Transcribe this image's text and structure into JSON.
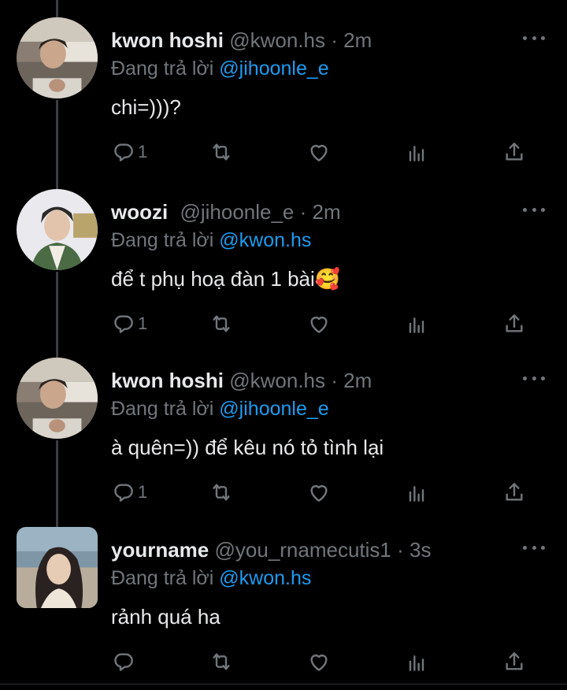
{
  "tweets": [
    {
      "display_name": "kwon hoshi",
      "handle": "@kwon.hs",
      "dot": "·",
      "time": "2m",
      "reply_prefix": "Đang trả lời",
      "reply_to": "@jihoonle_e",
      "text": "chi=)))?",
      "reply_count": "1",
      "avatar": "avatar-kwon-hoshi"
    },
    {
      "display_name": "woozi",
      "handle": "@jihoonle_e",
      "dot": "·",
      "time": "2m",
      "reply_prefix": "Đang trả lời",
      "reply_to": "@kwon.hs",
      "text": "để t phụ hoạ đàn 1 bài🥰",
      "reply_count": "1",
      "avatar": "avatar-woozi"
    },
    {
      "display_name": "kwon hoshi",
      "handle": "@kwon.hs",
      "dot": "·",
      "time": "2m",
      "reply_prefix": "Đang trả lời",
      "reply_to": "@jihoonle_e",
      "text": "à quên=)) để kêu nó tỏ tình lại",
      "reply_count": "1",
      "avatar": "avatar-kwon-hoshi"
    },
    {
      "display_name": "yourname",
      "handle": "@you_rnamecutis1",
      "dot": "·",
      "time": "3s",
      "reply_prefix": "Đang trả lời",
      "reply_to": "@kwon.hs",
      "text": "rảnh quá ha",
      "reply_count": "",
      "avatar": "avatar-yourname"
    }
  ],
  "icons": {
    "reply": "reply-icon",
    "retweet": "retweet-icon",
    "like": "heart-icon",
    "views": "analytics-icon",
    "share": "share-icon",
    "more": "more-icon"
  },
  "colors": {
    "background": "#000000",
    "text": "#e7e9ea",
    "muted": "#71767b",
    "link": "#1d9bf0",
    "thread_line": "#3a3d40"
  }
}
